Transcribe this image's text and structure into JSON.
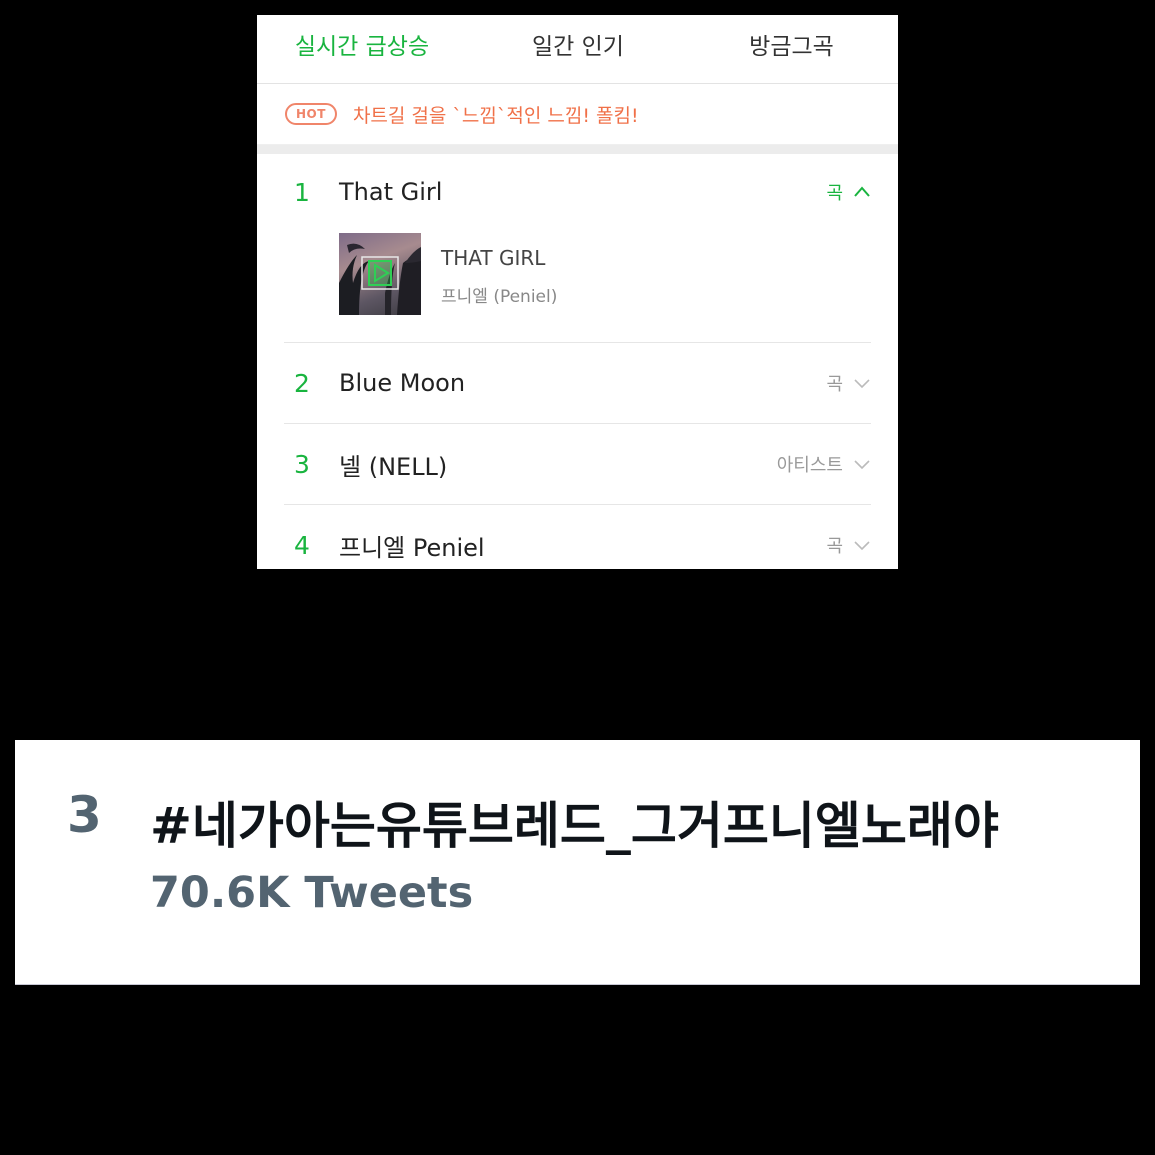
{
  "chart_app": {
    "tabs": [
      {
        "label": "실시간 급상승",
        "active": true
      },
      {
        "label": "일간 인기",
        "active": false
      },
      {
        "label": "방금그곡",
        "active": false
      }
    ],
    "hot": {
      "badge": "HOT",
      "text": "차트길 걸을 `느낌`적인 느낌! 폴킴!"
    },
    "ranks": [
      {
        "rank": "1",
        "title": "That Girl",
        "type": "곡",
        "expanded": true,
        "song": {
          "title": "THAT GIRL",
          "artist": "프니엘 (Peniel)"
        }
      },
      {
        "rank": "2",
        "title": "Blue Moon",
        "type": "곡",
        "expanded": false
      },
      {
        "rank": "3",
        "title": "넬 (NELL)",
        "type": "아티스트",
        "expanded": false
      },
      {
        "rank": "4",
        "title": "프니엘 Peniel",
        "type": "곡",
        "expanded": false
      }
    ],
    "colors": {
      "accent": "#19b43f",
      "hot": "#f07048"
    }
  },
  "trend": {
    "rank": "3",
    "hashtag": "#네가아는유튜브레드_그거프니엘노래야",
    "count": "70.6K Tweets"
  }
}
